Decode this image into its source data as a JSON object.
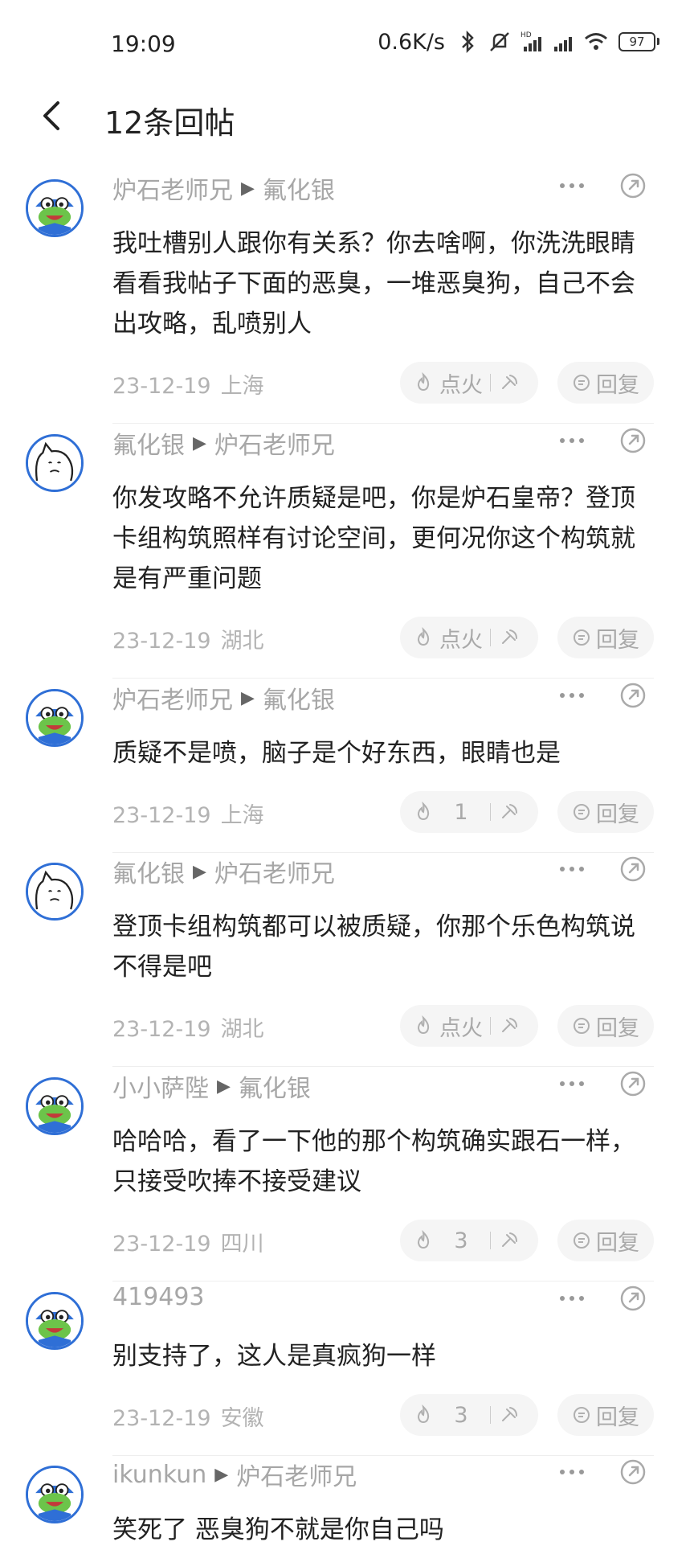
{
  "status_bar": {
    "time": "19:09",
    "net_speed": "0.6K/s",
    "battery": "97",
    "icons": [
      "bluetooth-icon",
      "mute-icon",
      "hd-signal-icon",
      "signal-icon",
      "wifi-icon",
      "battery-icon"
    ]
  },
  "header": {
    "back_icon": "chevron-left-icon",
    "title": "12条回帖"
  },
  "actions": {
    "fire_default_label": "点火",
    "reply_label": "回复"
  },
  "comments": [
    {
      "avatar": "frog-avatar",
      "author": "炉石老师兄",
      "reply_to": "氟化银",
      "text": "我吐槽别人跟你有关系？你去啥啊，你洗洗眼睛看看我帖子下面的恶臭，一堆恶臭狗，自己不会出攻略，乱喷别人",
      "date": "23-12-19",
      "region": "上海",
      "fire": "点火"
    },
    {
      "avatar": "cat-avatar",
      "author": "氟化银",
      "reply_to": "炉石老师兄",
      "text": "你发攻略不允许质疑是吧，你是炉石皇帝？登顶卡组构筑照样有讨论空间，更何况你这个构筑就是有严重问题",
      "date": "23-12-19",
      "region": "湖北",
      "fire": "点火"
    },
    {
      "avatar": "frog-avatar",
      "author": "炉石老师兄",
      "reply_to": "氟化银",
      "text": "质疑不是喷，脑子是个好东西，眼睛也是",
      "date": "23-12-19",
      "region": "上海",
      "fire": "1"
    },
    {
      "avatar": "cat-avatar",
      "author": "氟化银",
      "reply_to": "炉石老师兄",
      "text": "登顶卡组构筑都可以被质疑，你那个乐色构筑说不得是吧",
      "date": "23-12-19",
      "region": "湖北",
      "fire": "点火"
    },
    {
      "avatar": "frog-avatar",
      "author": "小小萨陛",
      "reply_to": "氟化银",
      "text": "哈哈哈，看了一下他的那个构筑确实跟石一样，只接受吹捧不接受建议",
      "date": "23-12-19",
      "region": "四川",
      "fire": "3"
    },
    {
      "avatar": "frog-avatar",
      "author": "419493",
      "reply_to": "",
      "text": "别支持了，这人是真疯狗一样",
      "date": "23-12-19",
      "region": "安徽",
      "fire": "3"
    },
    {
      "avatar": "frog-avatar",
      "author": "ikunkun",
      "reply_to": "炉石老师兄",
      "text": "笑死了 恶臭狗不就是你自己吗",
      "date": "",
      "region": "",
      "fire": ""
    }
  ]
}
